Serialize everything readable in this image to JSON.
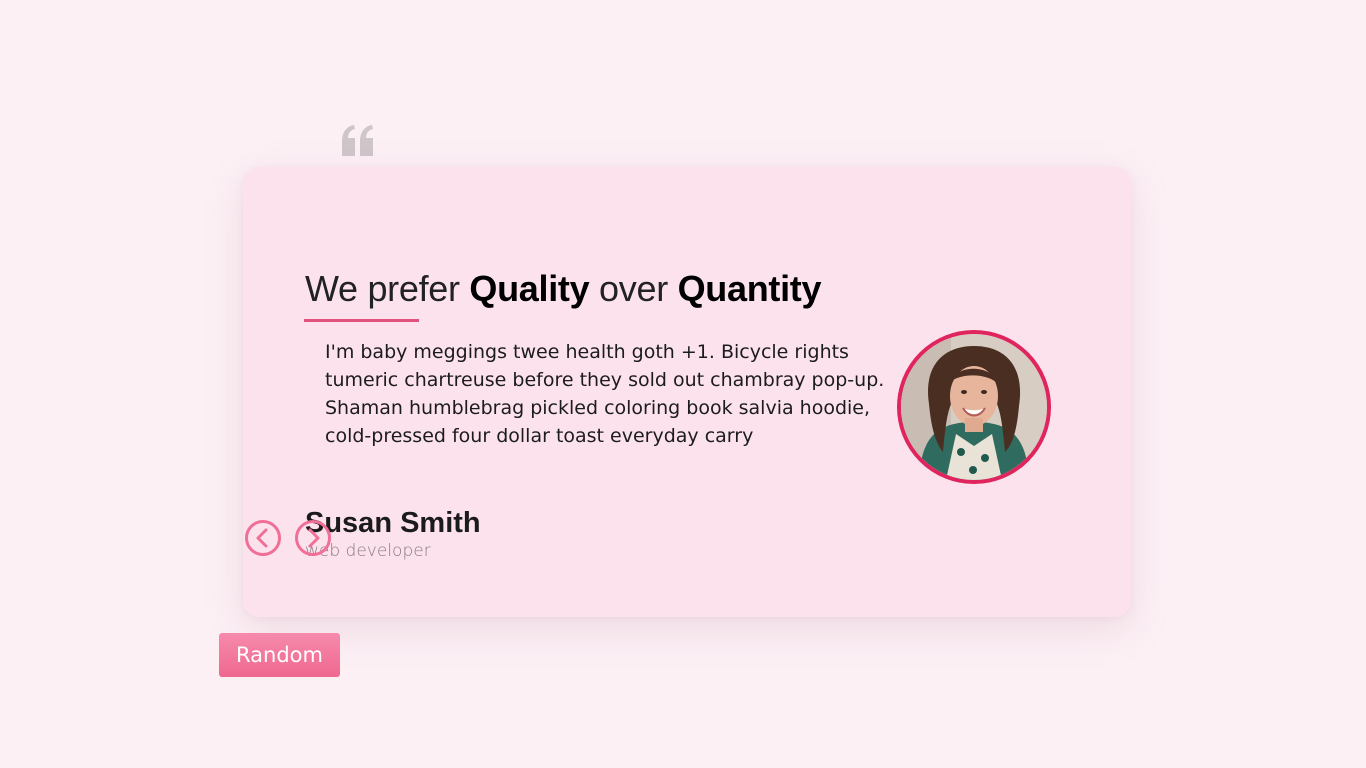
{
  "review": {
    "title_prefix": "We prefer ",
    "title_bold_1": "Quality",
    "title_middle": " over ",
    "title_bold_2": "Quantity",
    "text": "I'm baby meggings twee health goth +1. Bicycle rights tumeric chartreuse before they sold out chambray pop-up. Shaman humblebrag pickled coloring book salvia hoodie, cold-pressed four dollar toast everyday carry",
    "name": "Susan Smith",
    "job": "web developer"
  },
  "controls": {
    "random_label": "Random"
  },
  "icons": {
    "quote": "quote-left-icon",
    "prev": "chevron-left-icon",
    "next": "chevron-right-icon"
  },
  "colors": {
    "page_background": "#fcf0f5",
    "card_background": "#fce2ed",
    "accent": "#e0537f",
    "avatar_border": "#e0245e",
    "button": "#f0678f"
  }
}
